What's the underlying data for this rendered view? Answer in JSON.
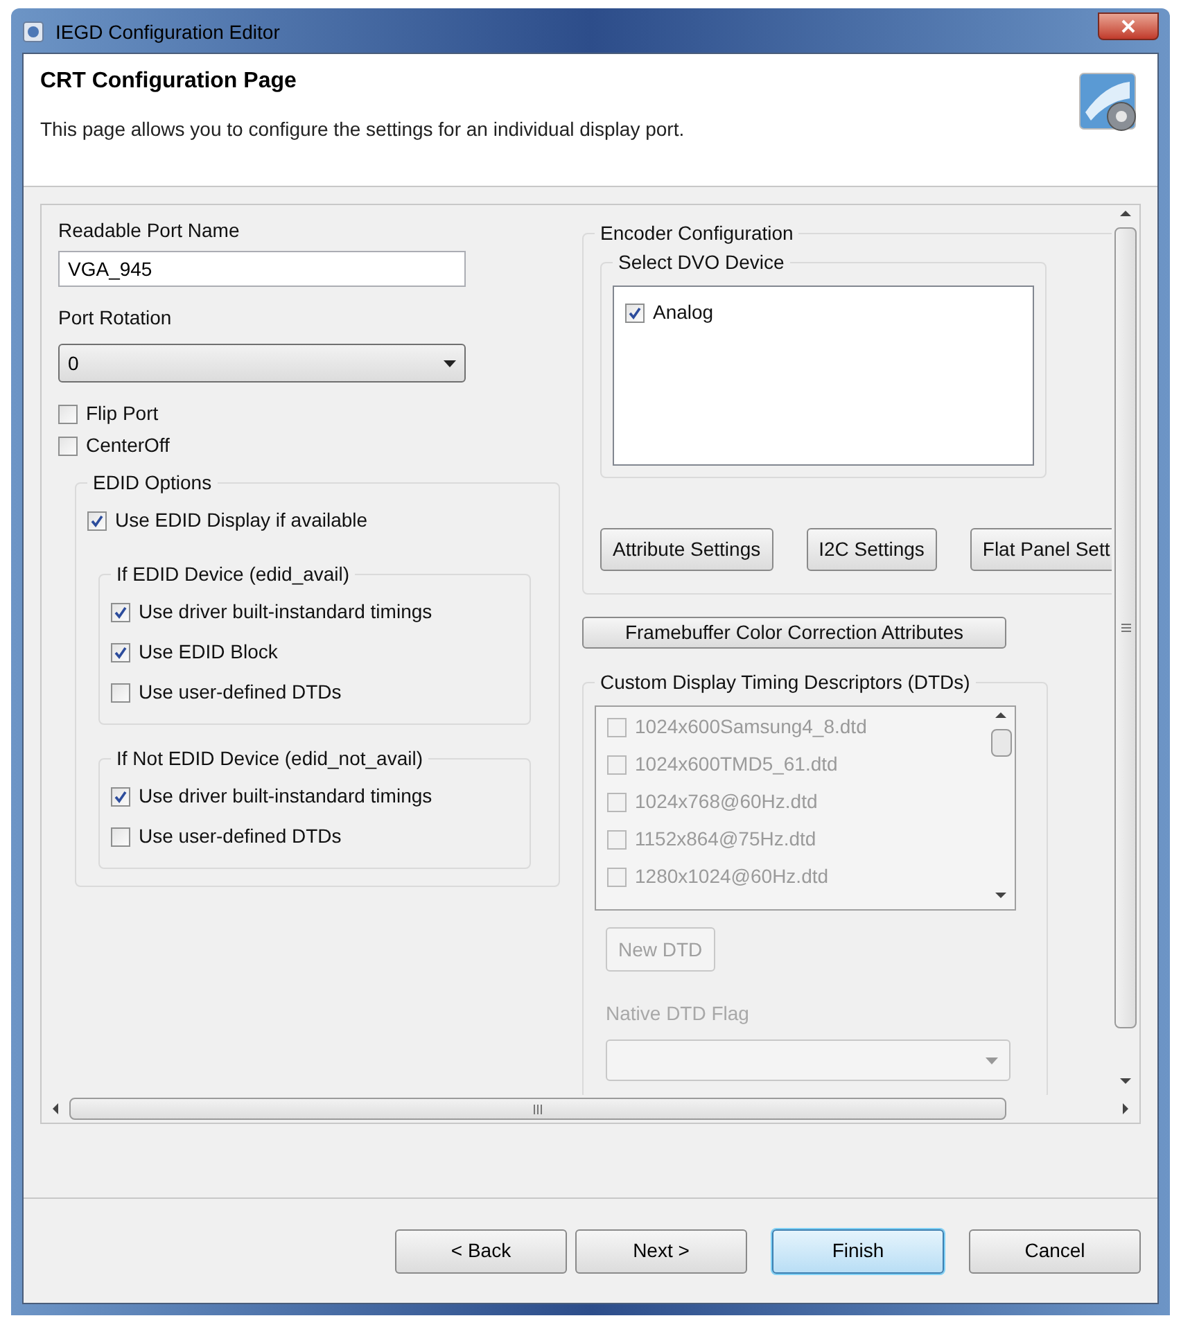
{
  "window": {
    "title": "IEGD Configuration Editor"
  },
  "header": {
    "title": "CRT Configuration Page",
    "description": "This page allows you to configure the settings for an individual display port."
  },
  "port_name": {
    "label": "Readable Port Name",
    "value": "VGA_945"
  },
  "port_rotation": {
    "label": "Port Rotation",
    "value": "0"
  },
  "port_options": [
    {
      "label": "Flip Port",
      "checked": false
    },
    {
      "label": "CenterOff",
      "checked": false
    }
  ],
  "edid_options": {
    "title": "EDID Options",
    "use_edid": {
      "label": "Use EDID Display if available",
      "checked": true
    },
    "groups": [
      {
        "title": "If EDID Device (edid_avail)",
        "options": [
          {
            "label": "Use driver built-instandard timings",
            "checked": true
          },
          {
            "label": "Use EDID Block",
            "checked": true
          },
          {
            "label": "Use user-defined DTDs",
            "checked": false
          }
        ]
      },
      {
        "title": "If Not EDID Device (edid_not_avail)",
        "options": [
          {
            "label": "Use driver built-instandard timings",
            "checked": true
          },
          {
            "label": "Use user-defined DTDs",
            "checked": false
          }
        ]
      }
    ]
  },
  "encoder": {
    "title": "Encoder Configuration",
    "dvo_title": "Select DVO Device",
    "devices": [
      {
        "label": "Analog",
        "checked": true
      }
    ],
    "buttons": [
      "Attribute Settings",
      "I2C Settings",
      "Flat Panel Sett"
    ]
  },
  "framebuffer_button": "Framebuffer Color Correction Attributes",
  "dtds": {
    "title": "Custom Display Timing Descriptors (DTDs)",
    "disabled": true,
    "items": [
      {
        "label": "1024x600Samsung4_8.dtd",
        "checked": false
      },
      {
        "label": "1024x600TMD5_61.dtd",
        "checked": false
      },
      {
        "label": "1024x768@60Hz.dtd",
        "checked": false
      },
      {
        "label": "1152x864@75Hz.dtd",
        "checked": false
      },
      {
        "label": "1280x1024@60Hz.dtd",
        "checked": false
      }
    ],
    "new_button": "New DTD",
    "flag_label": "Native DTD Flag"
  },
  "buttons": [
    {
      "label": "< Back",
      "default": false
    },
    {
      "label": "Next >",
      "default": false
    },
    {
      "label": "Finish",
      "default": true
    },
    {
      "label": "Cancel",
      "default": false
    }
  ]
}
